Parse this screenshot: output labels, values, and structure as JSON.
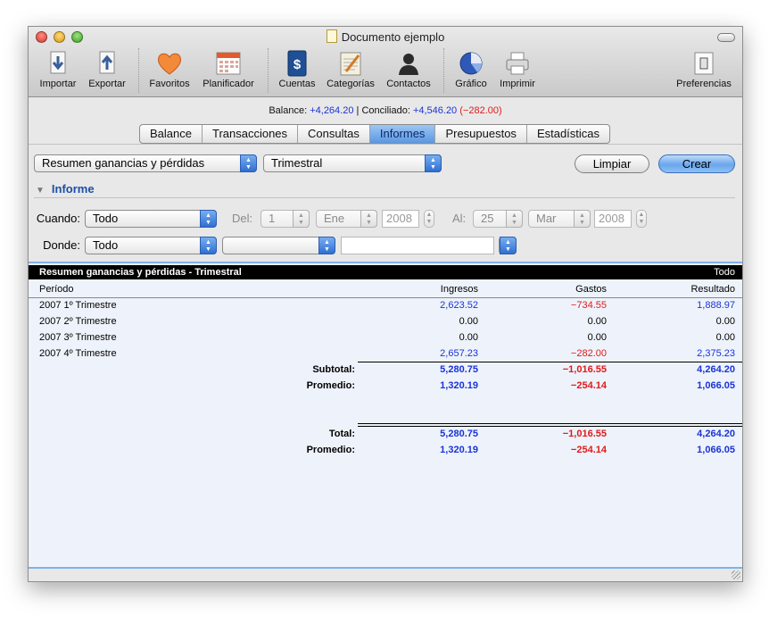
{
  "window": {
    "title": "Documento ejemplo"
  },
  "toolbar": {
    "importar": "Importar",
    "exportar": "Exportar",
    "favoritos": "Favoritos",
    "planificador": "Planificador",
    "cuentas": "Cuentas",
    "categorias": "Categorías",
    "contactos": "Contactos",
    "grafico": "Gráfico",
    "imprimir": "Imprimir",
    "preferencias": "Preferencias"
  },
  "balance": {
    "balance_label": "Balance:",
    "balance_value": "+4,264.20",
    "sep": "|",
    "conciliado_label": "Conciliado:",
    "conciliado_value": "+4,546.20",
    "diff_value": "(−282.00)"
  },
  "tabs": [
    "Balance",
    "Transacciones",
    "Consultas",
    "Informes",
    "Presupuestos",
    "Estadísticas"
  ],
  "selected_tab": "Informes",
  "controls": {
    "report_type": "Resumen ganancias y pérdidas",
    "period": "Trimestral",
    "limpiar": "Limpiar",
    "crear": "Crear",
    "informe": "Informe",
    "cuando_label": "Cuando:",
    "cuando_value": "Todo",
    "del_label": "Del:",
    "del_day": "1",
    "del_month": "Ene",
    "del_year": "2008",
    "al_label": "Al:",
    "al_day": "25",
    "al_month": "Mar",
    "al_year": "2008",
    "donde_label": "Donde:",
    "donde_value": "Todo",
    "donde_second": "",
    "donde_text": ""
  },
  "report": {
    "title": "Resumen ganancias y pérdidas - Trimestral",
    "scope": "Todo",
    "columns": [
      "Período",
      "Ingresos",
      "Gastos",
      "Resultado"
    ],
    "rows": [
      {
        "period": "2007 1º Trimestre",
        "ingresos": "2,623.52",
        "gastos": "−734.55",
        "resultado": "1,888.97"
      },
      {
        "period": "2007 2º Trimestre",
        "ingresos": "0.00",
        "gastos": "0.00",
        "resultado": "0.00"
      },
      {
        "period": "2007 3º Trimestre",
        "ingresos": "0.00",
        "gastos": "0.00",
        "resultado": "0.00"
      },
      {
        "period": "2007 4º Trimestre",
        "ingresos": "2,657.23",
        "gastos": "−282.00",
        "resultado": "2,375.23"
      }
    ],
    "subtotal": {
      "label": "Subtotal:",
      "ingresos": "5,280.75",
      "gastos": "−1,016.55",
      "resultado": "4,264.20"
    },
    "promedio1": {
      "label": "Promedio:",
      "ingresos": "1,320.19",
      "gastos": "−254.14",
      "resultado": "1,066.05"
    },
    "total": {
      "label": "Total:",
      "ingresos": "5,280.75",
      "gastos": "−1,016.55",
      "resultado": "4,264.20"
    },
    "promedio2": {
      "label": "Promedio:",
      "ingresos": "1,320.19",
      "gastos": "−254.14",
      "resultado": "1,066.05"
    }
  },
  "colors": {
    "positive": "#1a33d6",
    "negative": "#e01a1a",
    "tab_selected": "#5a98e2"
  },
  "icons": [
    "import-icon",
    "export-icon",
    "heart-icon",
    "calendar-icon",
    "accounts-book-icon",
    "categories-icon",
    "contacts-icon",
    "pie-chart-icon",
    "printer-icon",
    "switch-icon"
  ]
}
